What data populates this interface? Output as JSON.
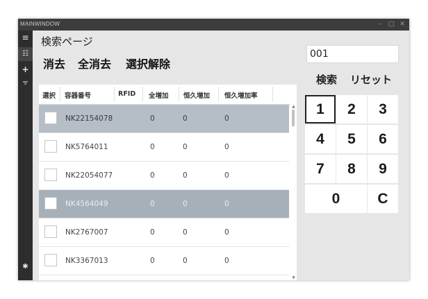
{
  "window": {
    "title": "MAINWINDOW",
    "minimize": "–",
    "maximize": "□",
    "close": "✕"
  },
  "sidebar": {
    "menu_glyph": "≡",
    "list_glyph": "☷",
    "add_glyph": "+",
    "wifi_glyph": "ᯤ",
    "settings_glyph": "✱"
  },
  "page": {
    "title": "検索ページ"
  },
  "toolbar": {
    "clear": "消去",
    "clear_all": "全消去",
    "deselect": "選択解除"
  },
  "table": {
    "headers": {
      "select": "選択",
      "container": "容器番号",
      "rfid": "RFID",
      "total": "全増加",
      "permanent": "恒久増加",
      "rate": "恒久増加率"
    },
    "rows": [
      {
        "container": "NK22154078",
        "rfid": "",
        "total": "0",
        "permanent": "0",
        "rate": "0"
      },
      {
        "container": "NK5764011",
        "rfid": "",
        "total": "0",
        "permanent": "0",
        "rate": "0"
      },
      {
        "container": "NK22054077",
        "rfid": "",
        "total": "0",
        "permanent": "0",
        "rate": "0"
      },
      {
        "container": "NK4564049",
        "rfid": "",
        "total": "0",
        "permanent": "0",
        "rate": "0"
      },
      {
        "container": "NK2767007",
        "rfid": "",
        "total": "0",
        "permanent": "0",
        "rate": "0"
      },
      {
        "container": "NK3367013",
        "rfid": "",
        "total": "0",
        "permanent": "0",
        "rate": "0"
      }
    ],
    "selected_rows": [
      0,
      3
    ]
  },
  "search": {
    "value": "001",
    "search_button": "検索",
    "reset_button": "リセット"
  },
  "keypad": {
    "k1": "1",
    "k2": "2",
    "k3": "3",
    "k4": "4",
    "k5": "5",
    "k6": "6",
    "k7": "7",
    "k8": "8",
    "k9": "9",
    "k0": "0",
    "kc": "C"
  },
  "colors": {
    "titlebar": "#3c3c3c",
    "sidebar": "#2d2d2d",
    "selected_row": "#b5bec6",
    "highlight_row": "#a6b0b9",
    "background": "#e6e6e6"
  }
}
